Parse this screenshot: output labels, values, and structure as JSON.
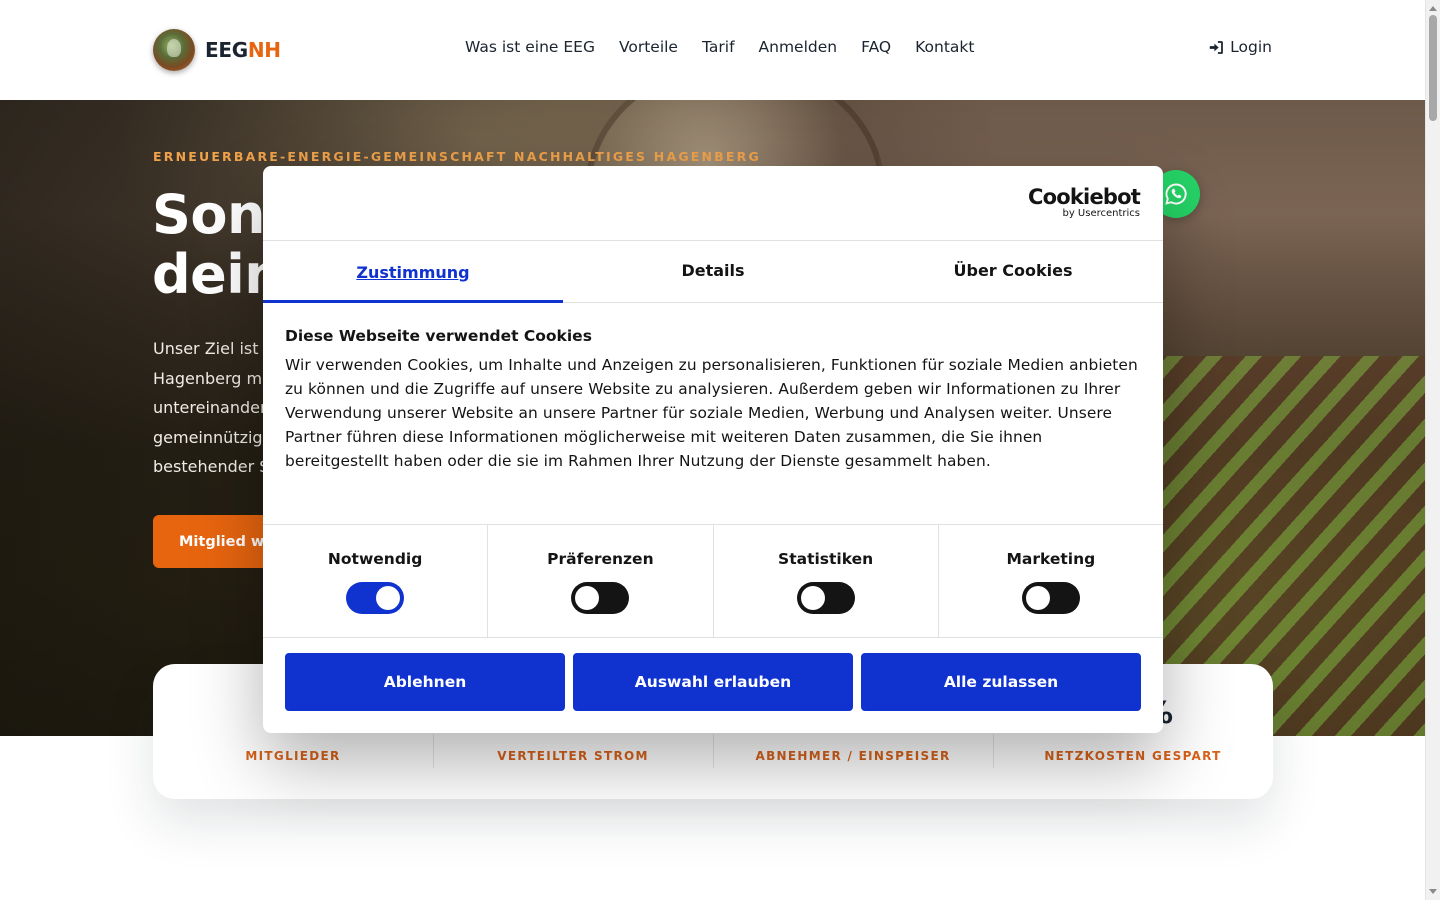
{
  "header": {
    "brand_part1": "EEG",
    "brand_part2": "NH",
    "nav": [
      {
        "label": "Was ist eine EEG"
      },
      {
        "label": "Vorteile"
      },
      {
        "label": "Tarif"
      },
      {
        "label": "Anmelden"
      },
      {
        "label": "FAQ"
      },
      {
        "label": "Kontakt"
      }
    ],
    "login_label": "Login",
    "login_icon": "sign-in-icon"
  },
  "hero": {
    "eyebrow": "ERNEUERBARE-ENERGIE-GEMEINSCHAFT NACHHALTIGES HAGENBERG",
    "title_line1": "Sonn",
    "title_line2": "dein",
    "text_lines": [
      "Unser Ziel ist",
      "Hagenberg mi",
      "untereinander",
      "gemeinnützig",
      "bestehender S"
    ],
    "cta_label": "Mitglied we",
    "whatsapp_icon": "whatsapp-icon"
  },
  "stats": {
    "items": [
      {
        "value": "",
        "label": "MITGLIEDER"
      },
      {
        "value": "",
        "label": "VERTEILTER STROM"
      },
      {
        "value": "",
        "label": "ABNEHMER / EINSPEISER"
      },
      {
        "value": "%",
        "label": "NETZKOSTEN GESPART"
      }
    ]
  },
  "cookie": {
    "logo_main": "Cookiebot",
    "logo_sub": "by Usercentrics",
    "tabs": [
      {
        "label": "Zustimmung",
        "active": true
      },
      {
        "label": "Details",
        "active": false
      },
      {
        "label": "Über Cookies",
        "active": false
      }
    ],
    "title": "Diese Webseite verwendet Cookies",
    "text": "Wir verwenden Cookies, um Inhalte und Anzeigen zu personalisieren, Funktionen für soziale Medien anbieten zu können und die Zugriffe auf unsere Website zu analysieren. Außerdem geben wir Informationen zu Ihrer Verwendung unserer Website an unsere Partner für soziale Medien, Werbung und Analysen weiter. Unsere Partner führen diese Informationen möglicherweise mit weiteren Daten zusammen, die Sie ihnen bereitgestellt haben oder die sie im Rahmen Ihrer Nutzung der Dienste gesammelt haben.",
    "toggles": [
      {
        "label": "Notwendig",
        "checked": true
      },
      {
        "label": "Präferenzen",
        "checked": false
      },
      {
        "label": "Statistiken",
        "checked": false
      },
      {
        "label": "Marketing",
        "checked": false
      }
    ],
    "buttons": {
      "decline": "Ablehnen",
      "allow_selection": "Auswahl erlauben",
      "allow_all": "Alle zulassen"
    }
  },
  "colors": {
    "accent_orange": "#e8650f",
    "cookiebot_blue": "#1032cf",
    "whatsapp_green": "#25d366"
  }
}
